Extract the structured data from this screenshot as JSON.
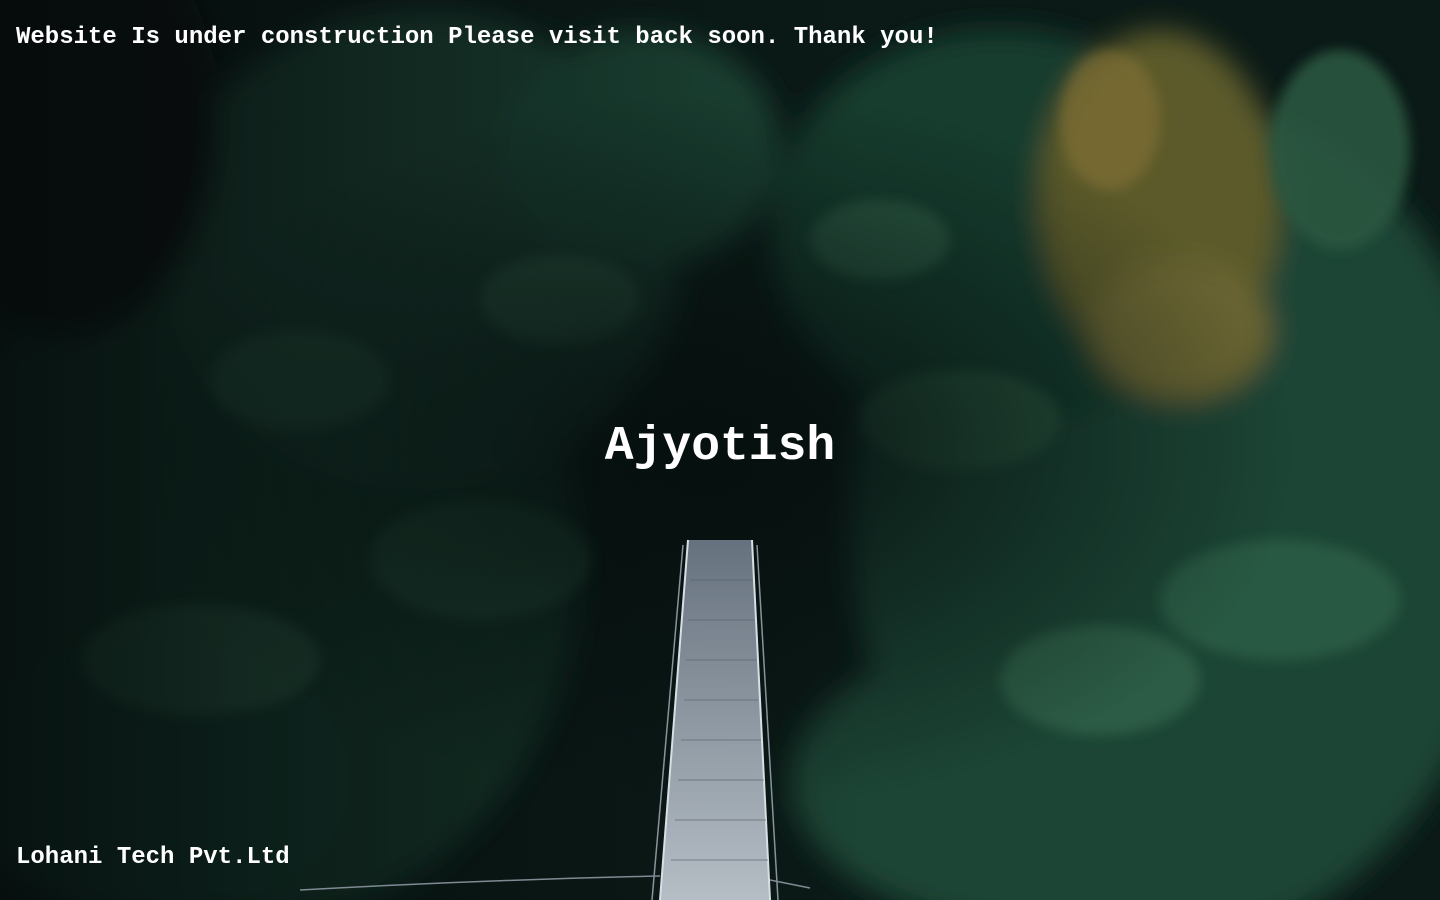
{
  "notice": {
    "text": "Website Is under construction Please visit back soon. Thank you!"
  },
  "brand": {
    "title": "Ajyotish"
  },
  "footer": {
    "company": "Lohani Tech Pvt.Ltd"
  },
  "background": {
    "description_icon": "forest-bridge-photo",
    "colors": {
      "dark": "#071210",
      "deep_green": "#123026",
      "mid_green": "#1f4a38",
      "light_green": "#2e5e45",
      "autumn": "#8a7436",
      "bridge": "#b9c2cc"
    }
  }
}
